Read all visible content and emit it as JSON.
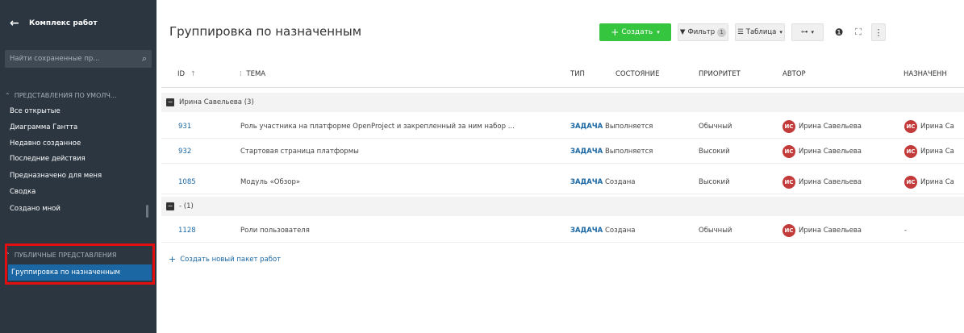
{
  "sidebar": {
    "title": "Комплекс работ",
    "search_placeholder": "Найти сохраненные пр...",
    "default_group": "ПРЕДСТАВЛЕНИЯ ПО УМОЛЧ...",
    "items": [
      "Все открытые",
      "Диаграмма Гантта",
      "Недавно созданное",
      "Последние действия",
      "Предназначено для меня",
      "Сводка",
      "Создано мной"
    ],
    "public_group": "ПУБЛИЧНЫЕ ПРЕДСТАВЛЕНИЯ",
    "active_item": "Группировка по назначенным"
  },
  "header": {
    "title": "Группировка по назначенным",
    "create_label": "Создать",
    "filter_label": "Фильтр",
    "filter_count": "1",
    "view_label": "Таблица"
  },
  "table": {
    "columns": [
      "ID",
      "ТЕМА",
      "ТИП",
      "СОСТОЯНИЕ",
      "ПРИОРИТЕТ",
      "АВТОР",
      "НАЗНАЧЕНН"
    ],
    "groups": [
      {
        "label": "Ирина Савельева (3)",
        "rows": [
          {
            "id": "931",
            "subject": "Роль участника на платформе OpenProject и закрепленный за ним набор ...",
            "type": "ЗАДАЧА",
            "status": "Выполняется",
            "priority": "Обычный",
            "author": "Ирина Савельева",
            "assignee": "Ирина Са",
            "initials": "ИС"
          },
          {
            "id": "932",
            "subject": "Стартовая страница платформы",
            "type": "ЗАДАЧА",
            "status": "Выполняется",
            "priority": "Высокий",
            "author": "Ирина Савельева",
            "assignee": "Ирина Са",
            "initials": "ИС"
          },
          {
            "id": "1085",
            "subject": "Модуль «Обзор»",
            "type": "ЗАДАЧА",
            "status": "Создана",
            "priority": "Высокий",
            "author": "Ирина Савельева",
            "assignee": "Ирина Са",
            "initials": "ИС"
          }
        ]
      },
      {
        "label": "- (1)",
        "rows": [
          {
            "id": "1128",
            "subject": "Роли пользователя",
            "type": "ЗАДАЧА",
            "status": "Создана",
            "priority": "Обычный",
            "author": "Ирина Савельева",
            "assignee": "-",
            "initials": "ИС"
          }
        ]
      }
    ],
    "create_new": "Создать новый пакет работ"
  },
  "colors": {
    "sidebar_bg": "#2b3641",
    "accent": "#1a67a3",
    "create_green": "#35c53f",
    "avatar": "#c33a3a",
    "highlight": "#e10f0f"
  }
}
